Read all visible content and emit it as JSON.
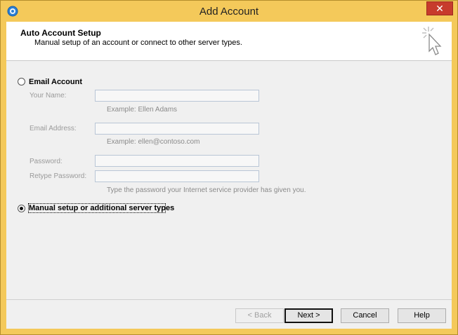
{
  "window": {
    "title": "Add Account",
    "close_label": "✕"
  },
  "header": {
    "title": "Auto Account Setup",
    "subtitle": "Manual setup of an account or connect to other server types."
  },
  "email_account": {
    "label": "Email Account",
    "selected": false,
    "fields": {
      "your_name": {
        "label": "Your Name:",
        "value": "",
        "hint": "Example: Ellen Adams"
      },
      "email_address": {
        "label": "Email Address:",
        "value": "",
        "hint": "Example: ellen@contoso.com"
      },
      "password": {
        "label": "Password:",
        "value": ""
      },
      "retype_password": {
        "label": "Retype Password:",
        "value": "",
        "hint": "Type the password your Internet service provider has given you."
      }
    }
  },
  "manual_setup": {
    "label": "Manual setup or additional server types",
    "selected": true
  },
  "buttons": {
    "back": "< Back",
    "next": "Next >",
    "cancel": "Cancel",
    "help": "Help"
  },
  "colors": {
    "title_bar": "#f4c95a",
    "close_button": "#c73b2c",
    "dialog_bg": "#f0f0f0",
    "header_bg": "#ffffff",
    "field_border": "#b9c6d6"
  },
  "icons": {
    "app": "outlook-app-icon",
    "header": "click-cursor-icon"
  }
}
